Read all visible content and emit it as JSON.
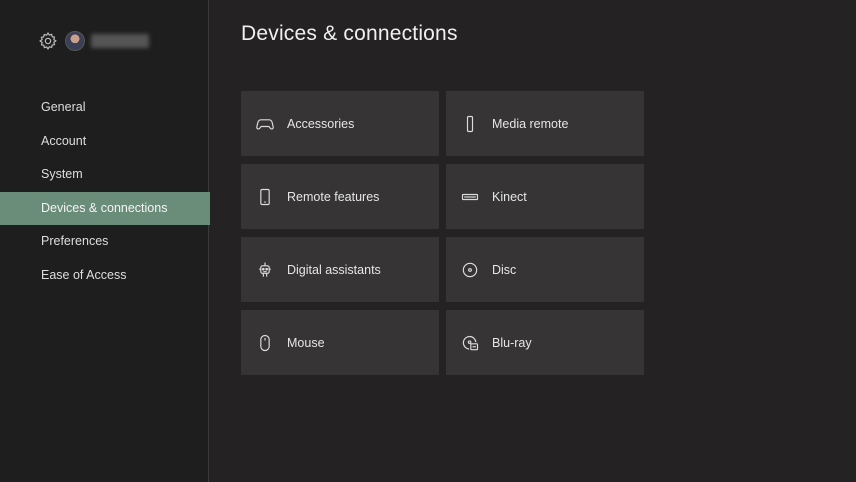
{
  "page": {
    "title": "Devices & connections"
  },
  "profile": {
    "gear_icon": "gear-icon",
    "avatar": "user-avatar"
  },
  "sidebar": {
    "items": [
      {
        "label": "General"
      },
      {
        "label": "Account"
      },
      {
        "label": "System"
      },
      {
        "label": "Devices & connections",
        "selected": true
      },
      {
        "label": "Preferences"
      },
      {
        "label": "Ease of Access"
      }
    ]
  },
  "tiles": [
    {
      "label": "Accessories",
      "icon": "gamepad-icon"
    },
    {
      "label": "Media remote",
      "icon": "media-remote-icon"
    },
    {
      "label": "Remote features",
      "icon": "phone-icon"
    },
    {
      "label": "Kinect",
      "icon": "kinect-icon"
    },
    {
      "label": "Digital assistants",
      "icon": "robot-icon"
    },
    {
      "label": "Disc",
      "icon": "disc-icon"
    },
    {
      "label": "Mouse",
      "icon": "mouse-icon"
    },
    {
      "label": "Blu-ray",
      "icon": "blu-ray-icon"
    }
  ],
  "colors": {
    "accent": "#6a8d7a",
    "background": "#242223",
    "tile": "#363435",
    "sidebar": "#1e1e1e"
  }
}
